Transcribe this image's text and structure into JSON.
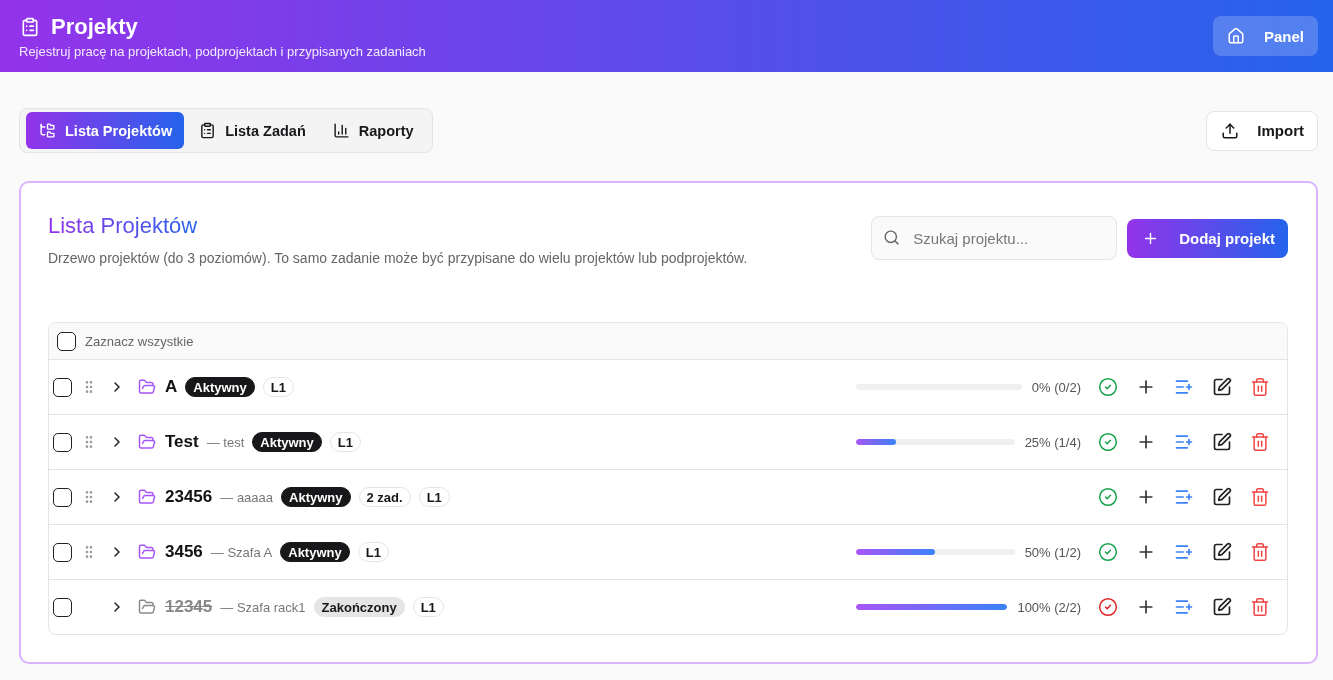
{
  "header": {
    "title": "Projekty",
    "subtitle": "Rejestruj pracę na projektach, podprojektach i przypisanych zadaniach",
    "panel_button": "Panel"
  },
  "tabs": [
    {
      "label": "Lista Projektów",
      "selected": true
    },
    {
      "label": "Lista Zadań",
      "selected": false
    },
    {
      "label": "Raporty",
      "selected": false
    }
  ],
  "import_button": "Import",
  "card": {
    "title": "Lista Projektów",
    "description": "Drzewo projektów (do 3 poziomów). To samo zadanie może być przypisane do wielu projektów lub podprojektów.",
    "search": {
      "placeholder": "Szukaj projektu..."
    },
    "add_button": "Dodaj projekt"
  },
  "table": {
    "select_all": {
      "label": "Zaznacz wszystkie",
      "checked": false
    },
    "rows": [
      {
        "name": "A",
        "checked": false,
        "expanded": false,
        "done": false,
        "badges": [
          {
            "text": "Aktywny",
            "kind": "active"
          },
          {
            "text": "L1",
            "kind": "level"
          }
        ],
        "progress": {
          "level": 0,
          "reading": "0% (0/2)"
        }
      },
      {
        "name": "Test",
        "note": "— test",
        "checked": false,
        "expanded": false,
        "done": false,
        "badges": [
          {
            "text": "Aktywny",
            "kind": "active"
          },
          {
            "text": "L1",
            "kind": "level"
          }
        ],
        "progress": {
          "level": 0.25,
          "reading": "25% (1/4)"
        }
      },
      {
        "name": "23456",
        "note": "— aaaaa",
        "checked": false,
        "expanded": false,
        "done": false,
        "badges": [
          {
            "text": "Aktywny",
            "kind": "active"
          },
          {
            "text": "2 zad.",
            "kind": "count"
          },
          {
            "text": "L1",
            "kind": "level"
          }
        ]
      },
      {
        "name": "3456",
        "note": "— Szafa A",
        "checked": false,
        "expanded": false,
        "done": false,
        "badges": [
          {
            "text": "Aktywny",
            "kind": "active"
          },
          {
            "text": "L1",
            "kind": "level"
          }
        ],
        "progress": {
          "level": 0.5,
          "reading": "50% (1/2)"
        }
      },
      {
        "name": "12345",
        "note": "— Szafa rack1",
        "checked": false,
        "expanded": false,
        "done": true,
        "badges": [
          {
            "text": "Zakończony",
            "kind": "done"
          },
          {
            "text": "L1",
            "kind": "level"
          }
        ],
        "progress": {
          "level": 1,
          "reading": "100% (2/2)"
        }
      }
    ]
  }
}
